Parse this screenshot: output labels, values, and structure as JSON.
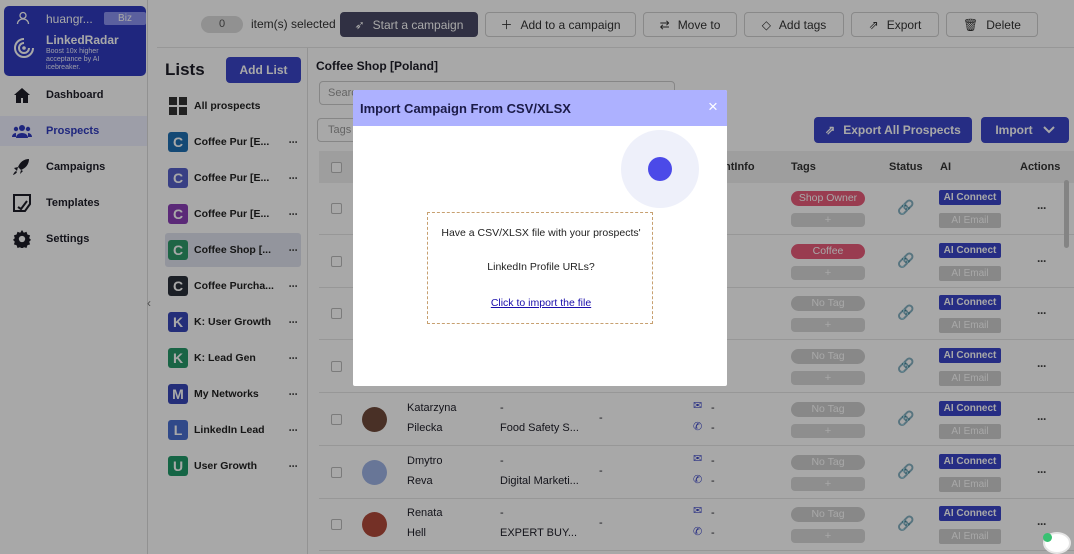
{
  "colors": {
    "primary": "#3b45c8",
    "modal_header": "#adb1ff",
    "spinner": "#4b4ae8",
    "tag_pink": "#e85b7a"
  },
  "sidebar": {
    "user_name": "huangr...",
    "plan_badge": "Biz",
    "brand": "LinkedRadar",
    "tagline": "Boost 10x higher acceptance by AI icebreaker.",
    "nav": [
      {
        "label": "Dashboard",
        "icon": "home-icon"
      },
      {
        "label": "Prospects",
        "icon": "users-icon",
        "active": true
      },
      {
        "label": "Campaigns",
        "icon": "rocket-icon"
      },
      {
        "label": "Templates",
        "icon": "template-icon"
      },
      {
        "label": "Settings",
        "icon": "gear-icon"
      }
    ]
  },
  "toolbar": {
    "count": "0",
    "selected_label": "item(s) selected",
    "start_campaign": "Start a campaign",
    "add_campaign": "Add to a campaign",
    "move_to": "Move to",
    "add_tags": "Add tags",
    "export": "Export",
    "delete": "Delete"
  },
  "lists": {
    "heading": "Lists",
    "add_list": "Add List",
    "all_prospects": "All prospects",
    "items": [
      {
        "badge": "C",
        "color": "#1f6fb2",
        "name": "Coffee Pur [E..."
      },
      {
        "badge": "C",
        "color": "#5560c8",
        "name": "Coffee Pur [E..."
      },
      {
        "badge": "C",
        "color": "#8a3fb6",
        "name": "Coffee Pur [E..."
      },
      {
        "badge": "C",
        "color": "#2e9a6a",
        "name": "Coffee Shop [..."
      },
      {
        "badge": "C",
        "color": "#2a2f3a",
        "name": "Coffee Purcha..."
      },
      {
        "badge": "K",
        "color": "#3847b8",
        "name": "K: User Growth"
      },
      {
        "badge": "K",
        "color": "#27986a",
        "name": "K: Lead Gen"
      },
      {
        "badge": "M",
        "color": "#3847b8",
        "name": "My Networks"
      },
      {
        "badge": "L",
        "color": "#4a6fd0",
        "name": "LinkedIn Lead"
      },
      {
        "badge": "U",
        "color": "#219a6a",
        "name": "User Growth"
      }
    ]
  },
  "main": {
    "title": "Coffee Shop [Poland]",
    "search_placeholder": "Searc",
    "tags_placeholder": "Tags",
    "export_all": "Export All Prospects",
    "import": "Import",
    "columns": {
      "contact": "ntInfo",
      "tags": "Tags",
      "status": "Status",
      "ai": "AI",
      "actions": "Actions"
    },
    "ai_connect": "AI Connect",
    "ai_email": "AI Email",
    "plus": "+",
    "rows": [
      {
        "first": "",
        "last": "",
        "company": "",
        "title": "",
        "location": "",
        "tag": "Shop Owner",
        "tag_color": "#e85b7a"
      },
      {
        "first": "",
        "last": "",
        "company": "",
        "title": "",
        "location": "",
        "tag": "Coffee Purchase",
        "tag_color": "#e85b7a"
      },
      {
        "first": "",
        "last": "",
        "company": "",
        "title": "",
        "location": "",
        "tag": "No Tag",
        "tag_color": "#cfcfcf"
      },
      {
        "first": "",
        "last": "",
        "company": "",
        "title": "",
        "location": "",
        "tag": "No Tag",
        "tag_color": "#cfcfcf"
      },
      {
        "first": "Katarzyna",
        "last": "Pilecka",
        "company": "-",
        "title": "Food Safety S...",
        "location": "-",
        "email": "-",
        "phone": "-",
        "tag": "No Tag",
        "tag_color": "#cfcfcf",
        "avatar": "#6f4a3a"
      },
      {
        "first": "Dmytro",
        "last": "Reva",
        "company": "-",
        "title": "Digital Marketi...",
        "location": "-",
        "email": "-",
        "phone": "-",
        "tag": "No Tag",
        "tag_color": "#cfcfcf",
        "avatar": "#9fb3e6"
      },
      {
        "first": "Renata",
        "last": "Hell",
        "company": "-",
        "title": "EXPERT BUY...",
        "location": "-",
        "email": "-",
        "phone": "-",
        "tag": "No Tag",
        "tag_color": "#cfcfcf",
        "avatar": "#b04a3a"
      }
    ]
  },
  "modal": {
    "title": "Import Campaign From CSV/XLSX",
    "close": "×",
    "line1": "Have a CSV/XLSX file with your prospects'",
    "line2": "LinkedIn Profile URLs?",
    "link": "Click to import the file"
  }
}
